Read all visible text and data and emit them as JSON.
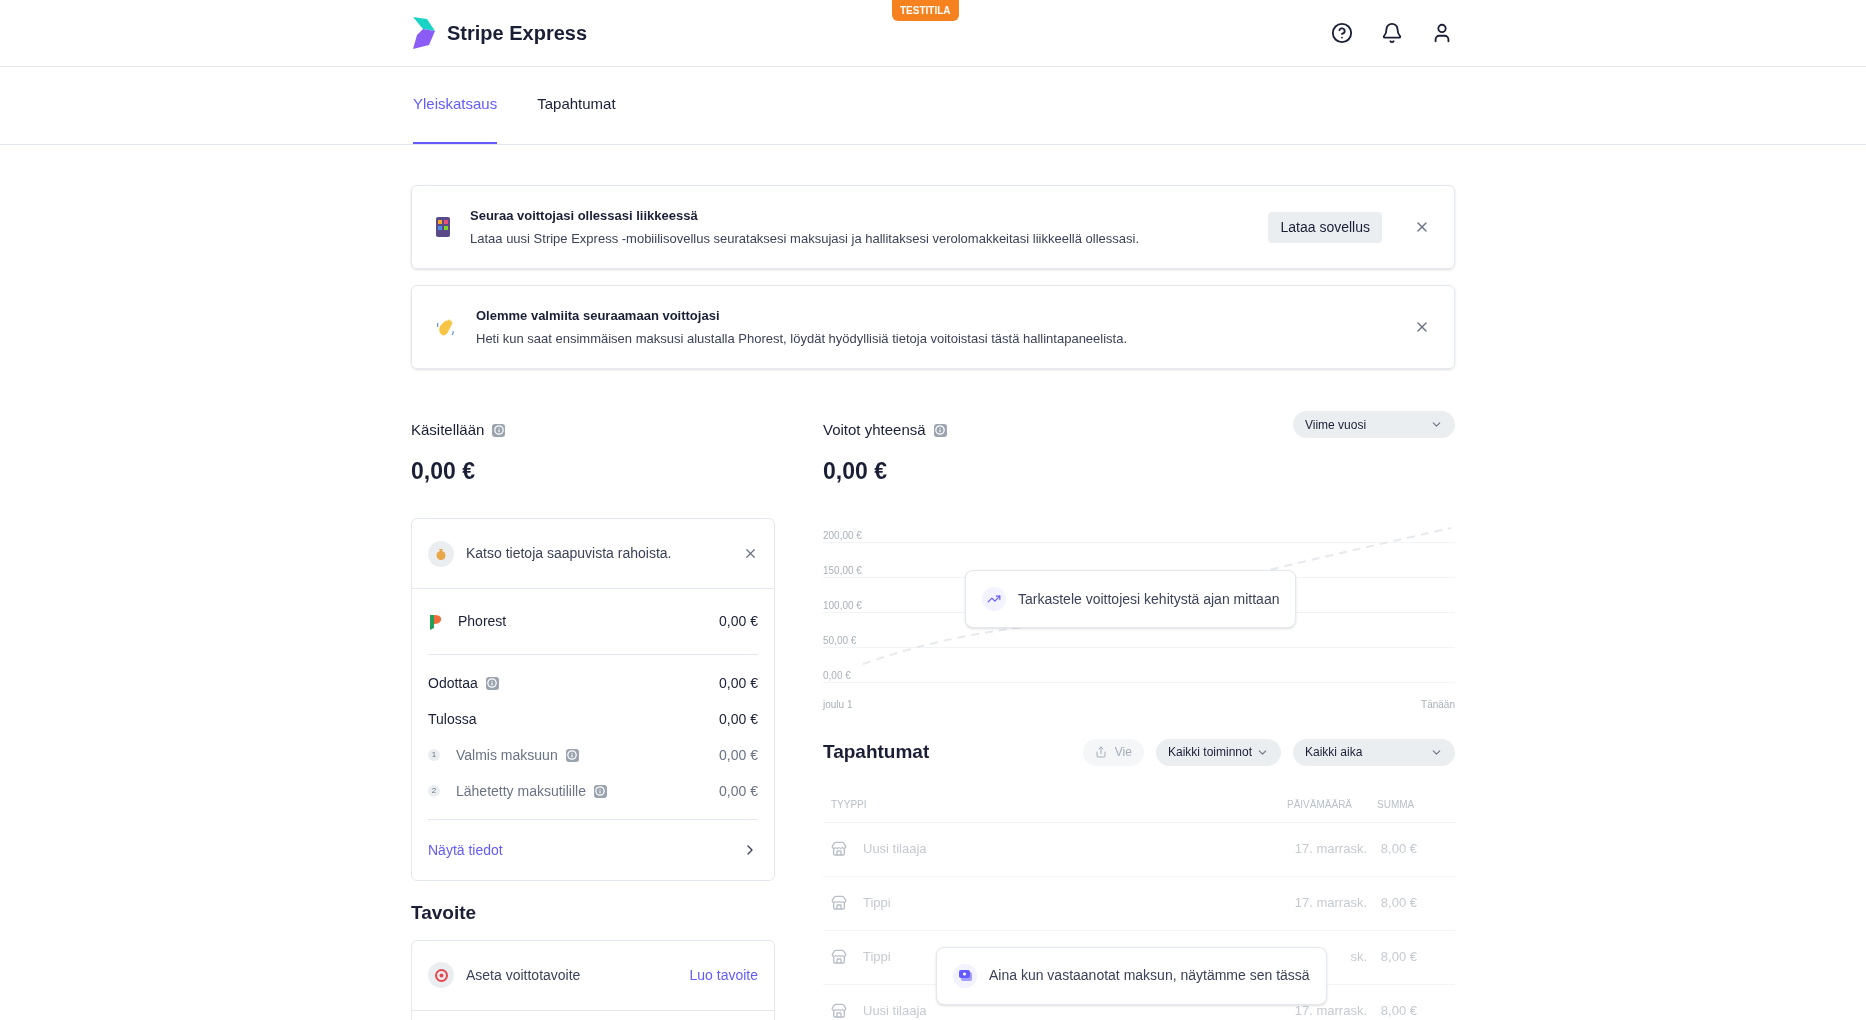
{
  "header": {
    "brand": "Stripe Express",
    "mode_badge": "TESTITILA"
  },
  "tabs": [
    {
      "label": "Yleiskatsaus",
      "selected": true
    },
    {
      "label": "Tapahtumat",
      "selected": false
    }
  ],
  "banners": [
    {
      "kind": "phone",
      "title": "Seuraa voittojasi ollessasi liikkeessä",
      "text": "Lataa uusi Stripe Express -mobiilisovellus seurataksesi maksujasi ja hallitaksesi verolomakkeitasi liikkeellä ollessasi.",
      "button": "Lataa sovellus"
    },
    {
      "kind": "wave",
      "title": "Olemme valmiita seuraamaan voittojasi",
      "text": "Heti kun saat ensimmäisen maksusi alustalla Phorest, löydät hyödyllisiä tietoja voitoistasi tästä hallintapaneelista."
    }
  ],
  "processing": {
    "title": "Käsitellään",
    "amount": "0,00 €",
    "notice": "Katso tietoja saapuvista rahoista.",
    "platform": {
      "name": "Phorest",
      "amount": "0,00 €"
    },
    "rows": [
      {
        "kind": "main",
        "label": "Odottaa",
        "info": true,
        "amount": "0,00 €"
      },
      {
        "kind": "main",
        "label": "Tulossa",
        "info": false,
        "amount": "0,00 €"
      },
      {
        "kind": "step",
        "step": "1",
        "label": "Valmis maksuun",
        "info": true,
        "amount": "0,00 €"
      },
      {
        "kind": "step",
        "step": "2",
        "label": "Lähetetty maksutilille",
        "info": true,
        "amount": "0,00 €"
      }
    ],
    "link": "Näytä tiedot"
  },
  "goal": {
    "title": "Tavoite",
    "label": "Aseta voittotavoite",
    "action": "Luo tavoite"
  },
  "earnings": {
    "title": "Voitot yhteensä",
    "amount": "0,00 €",
    "period": "Viime vuosi",
    "y_labels": [
      "200,00 €",
      "150,00 €",
      "100,00 €",
      "50,00 €",
      "0,00 €"
    ],
    "x_labels": [
      "joulu 1",
      "Tänään"
    ],
    "hint": "Tarkastele voittojesi kehitystä ajan mittaan"
  },
  "transactions": {
    "title": "Tapahtumat",
    "export": "Vie",
    "filter_activity": "Kaikki toiminnot",
    "filter_time": "Kaikki aika",
    "columns": [
      "TYYPPI",
      "PÄIVÄMÄÄRÄ",
      "SUMMA"
    ],
    "rows": [
      {
        "type": "Uusi tilaaja",
        "date": "17. marrask.",
        "amount": "8,00 €"
      },
      {
        "type": "Tippi",
        "date": "17. marrask.",
        "amount": "8,00 €"
      },
      {
        "type": "Tippi",
        "date": "sk.",
        "amount": "8,00 €"
      },
      {
        "type": "Uusi tilaaja",
        "date": "17. marrask.",
        "amount": "8,00 €"
      }
    ],
    "hint": "Aina kun vastaanotat maksun, näytämme sen tässä"
  }
}
